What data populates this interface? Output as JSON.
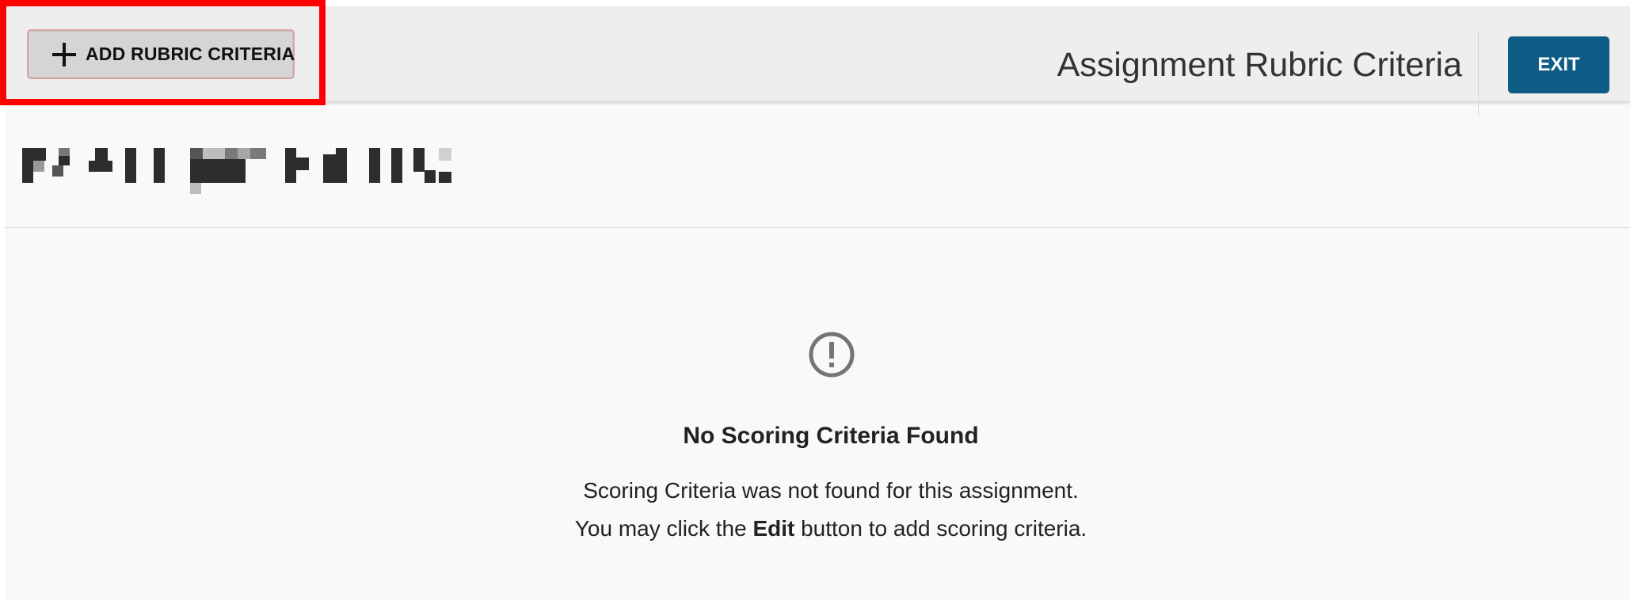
{
  "toolbar": {
    "add_button_label": "ADD RUBRIC CRITERIA",
    "title": "Assignment Rubric Criteria",
    "exit_label": "EXIT"
  },
  "empty_state": {
    "icon": "alert-circle-icon",
    "title": "No Scoring Criteria Found",
    "line1": "Scoring Criteria was not found for this assignment.",
    "line2_prefix": "You may click the ",
    "line2_bold": "Edit",
    "line2_suffix": " button to add scoring criteria."
  },
  "colors": {
    "toolbar_bg": "#eeeeee",
    "page_bg": "#f9f9f9",
    "exit_button": "#0f5c86",
    "highlight": "#ff0000",
    "icon_gray": "#757575"
  }
}
